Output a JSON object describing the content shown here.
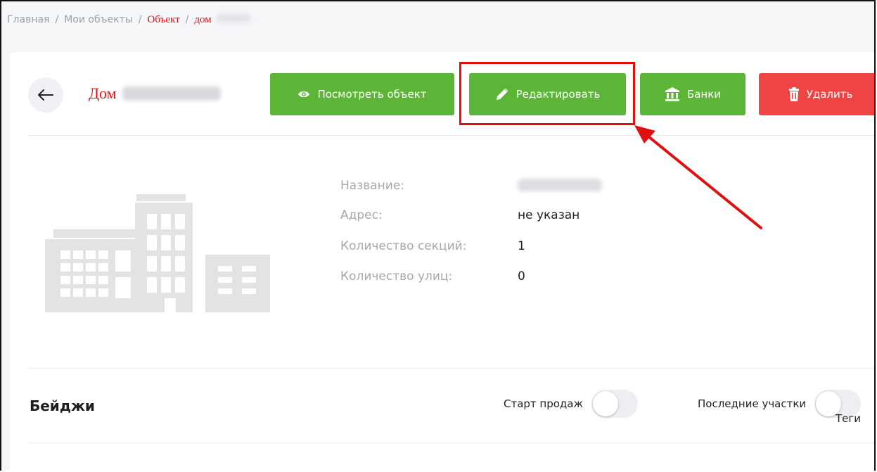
{
  "breadcrumb": {
    "home": "Главная",
    "my_objects": "Мои объекты",
    "object": "Объект",
    "house": "дом"
  },
  "header": {
    "back_icon": "arrow-left-icon",
    "title": "Дом"
  },
  "toolbar": {
    "view_label": "Посмотреть объект",
    "edit_label": "Редактировать",
    "banks_label": "Банки",
    "delete_label": "Удалить"
  },
  "details": {
    "name_label": "Название:",
    "address_label": "Адрес:",
    "address_value": "не указан",
    "sections_label": "Количество секций:",
    "sections_value": "1",
    "streets_label": "Количество улиц:",
    "streets_value": "0"
  },
  "badges": {
    "title": "Бейджи",
    "start_sales_label": "Старт продаж",
    "start_sales_on": false,
    "last_plots_label": "Последние участки",
    "last_plots_on": false
  },
  "tags": {
    "label": "Теги"
  },
  "colors": {
    "green": "#5cb536",
    "red": "#f04444",
    "annotation": "#e01010"
  }
}
